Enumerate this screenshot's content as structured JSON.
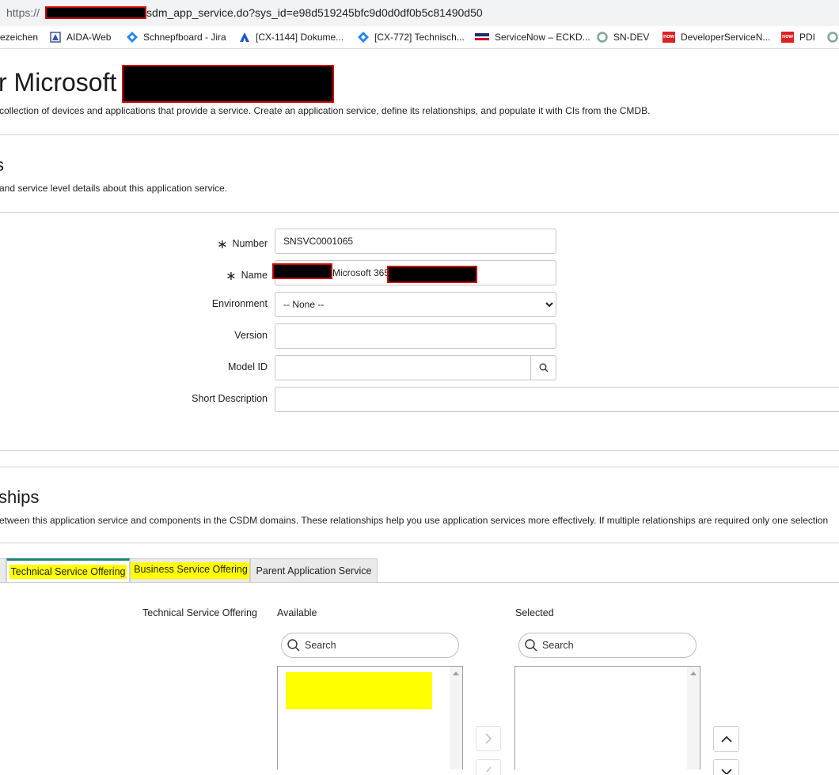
{
  "browser": {
    "url_prefix": "https://",
    "url_path": "csdm_app_service.do?sys_id=e98d519245bfc9d0d0df0b5c81490d50",
    "bookmarks": [
      {
        "label": "ezeichen",
        "icon": "bookmark-folder-icon"
      },
      {
        "label": "AIDA-Web",
        "icon": "aida-icon"
      },
      {
        "label": "Schnepfboard - Jira",
        "icon": "jira-icon"
      },
      {
        "label": "[CX-1144] Dokume...",
        "icon": "confluence-icon"
      },
      {
        "label": "[CX-772] Technisch...",
        "icon": "jira-icon"
      },
      {
        "label": "ServiceNow – ECKD...",
        "icon": "eckd-icon"
      },
      {
        "label": "SN-DEV",
        "icon": "servicenow-icon"
      },
      {
        "label": "DeveloperServiceN...",
        "icon": "now-icon"
      },
      {
        "label": "PDI",
        "icon": "now-icon"
      }
    ],
    "now_badge": "now"
  },
  "header": {
    "title": "r Microsoft",
    "description": "collection of devices and applications that provide a service. Create an application service, define its relationships, and populate it with CIs from the CMDB."
  },
  "details_section": {
    "title": "s",
    "description": "and service level details about this application service."
  },
  "form": {
    "required_mark": "∗",
    "number_label": "Number",
    "number_value": "SNSVC0001065",
    "name_label": "Name",
    "name_value": "Microsoft 365",
    "environment_label": "Environment",
    "environment_value": "-- None --",
    "version_label": "Version",
    "version_value": "",
    "model_id_label": "Model ID",
    "model_id_value": "",
    "short_description_label": "Short Description",
    "short_description_value": ""
  },
  "relationships_section": {
    "title": "ships",
    "description": "etween this application service and components in the CSDM domains. These relationships help you use application services more effectively. If multiple relationships are required only one selection"
  },
  "tabs": [
    {
      "label": "Technical Service Offering",
      "active": true
    },
    {
      "label": "Business Service Offering",
      "active": false
    },
    {
      "label": "Parent Application Service",
      "active": false
    }
  ],
  "slushbucket": {
    "field_label": "Technical Service Offering",
    "available_label": "Available",
    "selected_label": "Selected",
    "available_search_placeholder": "Search",
    "selected_search_placeholder": "Search"
  },
  "colors": {
    "highlight": "#ffff00",
    "active_tab_accent": "#1f8476",
    "redaction_border": "#d00000"
  }
}
